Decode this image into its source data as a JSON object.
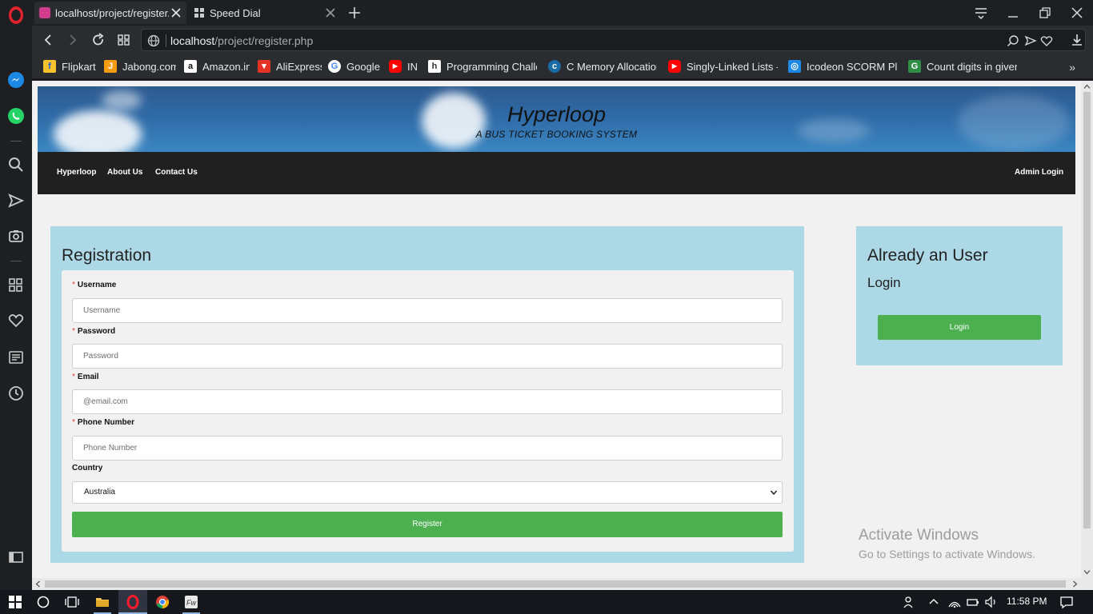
{
  "browser": {
    "tabs": [
      {
        "title": "localhost/project/register.p",
        "active": true
      },
      {
        "title": "Speed Dial",
        "active": false
      }
    ],
    "url_host": "localhost",
    "url_path": "/project/register.php",
    "bookmarks": [
      {
        "label": "Flipkart",
        "icon": "flipkart-icon",
        "color": "#f7c22d"
      },
      {
        "label": "Jabong.com",
        "icon": "jabong-icon",
        "color": "#f39c12"
      },
      {
        "label": "Amazon.in",
        "icon": "amazon-icon",
        "color": "#ffffff"
      },
      {
        "label": "AliExpress",
        "icon": "aliexpress-icon",
        "color": "#e43225"
      },
      {
        "label": "Google",
        "icon": "google-icon",
        "color": "#ffffff"
      },
      {
        "label": "IN",
        "icon": "youtube-icon",
        "color": "#ff0000"
      },
      {
        "label": "Programming Challe",
        "icon": "hackerearth-icon",
        "color": "#ffffff"
      },
      {
        "label": "C Memory Allocation",
        "icon": "c-icon",
        "color": "#1a6aa3"
      },
      {
        "label": "Singly-Linked Lists - Y",
        "icon": "youtube-icon",
        "color": "#ff0000"
      },
      {
        "label": "Icodeon SCORM Play",
        "icon": "icodeon-icon",
        "color": "#1e88e5"
      },
      {
        "label": "Count digits in given",
        "icon": "geeksforgeeks-icon",
        "color": "#2f8d46"
      }
    ]
  },
  "site": {
    "title": "Hyperloop",
    "tagline": "A BUS TICKET BOOKING SYSTEM",
    "nav": {
      "home": "Hyperloop",
      "about": "About Us",
      "contact": "Contact Us",
      "admin": "Admin Login"
    }
  },
  "registration": {
    "heading": "Registration",
    "username_label": "Username",
    "username_placeholder": "Username",
    "password_label": "Password",
    "password_placeholder": "Password",
    "email_label": "Email",
    "email_placeholder": "@email.com",
    "phone_label": "Phone Number",
    "phone_placeholder": "Phone Number",
    "country_label": "Country",
    "country_value": "Australia",
    "required_marker": "*",
    "submit_label": "Register"
  },
  "side": {
    "heading": "Already an User",
    "sub": "Login",
    "login_label": "Login"
  },
  "watermark": {
    "line1": "Activate Windows",
    "line2": "Go to Settings to activate Windows."
  },
  "taskbar": {
    "clock": "11:58 PM"
  },
  "colors": {
    "card_bg": "#add8e6",
    "button_green": "#4caf50",
    "nav_bg": "#202020",
    "opera_red": "#e0232e"
  }
}
